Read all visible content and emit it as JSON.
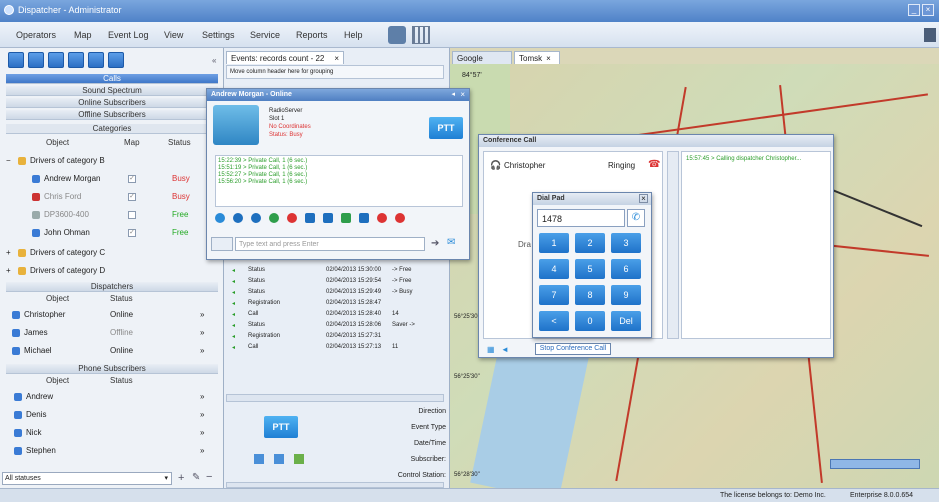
{
  "window": {
    "title": "Dispatcher - Administrator"
  },
  "menu": {
    "items": [
      "Operators",
      "Map",
      "Event Log",
      "View",
      "Settings",
      "Service",
      "Reports",
      "Help"
    ]
  },
  "left": {
    "calls": "Calls",
    "sound_spectrum": "Sound Spectrum",
    "online_subscribers": "Online Subscribers",
    "offline_subscribers": "Offline Subscribers",
    "categories": "Categories",
    "cat_headers": {
      "object": "Object",
      "map": "Map",
      "status": "Status"
    },
    "group_b": "Drivers of category B",
    "subscribers": [
      {
        "name": "Andrew Morgan",
        "status": "Busy",
        "checked": true
      },
      {
        "name": "Chris Ford",
        "status": "Busy",
        "checked": true
      },
      {
        "name": "DP3600-400",
        "status": "Free",
        "checked": false
      },
      {
        "name": "John Ohman",
        "status": "Free",
        "checked": true
      }
    ],
    "group_c": "Drivers of category C",
    "group_d": "Drivers of category D",
    "dispatchers": "Dispatchers",
    "disp_headers": {
      "object": "Object",
      "status": "Status"
    },
    "dispatcher_list": [
      {
        "name": "Christopher",
        "status": "Online"
      },
      {
        "name": "James",
        "status": "Offline"
      },
      {
        "name": "Michael",
        "status": "Online"
      }
    ],
    "phone_subscribers": "Phone Subscribers",
    "phone_headers": {
      "object": "Object",
      "status": "Status"
    },
    "phone_list": [
      "Andrew",
      "Denis",
      "Nick",
      "Stephen"
    ],
    "filter_value": "All statuses"
  },
  "center": {
    "tab": "Events: records count - 22",
    "group_hint": "Move column header here for grouping",
    "events": [
      {
        "type": "Status",
        "time": "02/04/2013 15:30:00",
        "detail": "-> Free"
      },
      {
        "type": "Status",
        "time": "02/04/2013 15:29:54",
        "detail": "-> Free"
      },
      {
        "type": "Status",
        "time": "02/04/2013 15:29:49",
        "detail": "-> Busy"
      },
      {
        "type": "Registration",
        "time": "02/04/2013 15:28:47",
        "detail": ""
      },
      {
        "type": "Call",
        "time": "02/04/2013 15:28:40",
        "detail": "14"
      },
      {
        "type": "Status",
        "time": "02/04/2013 15:28:06",
        "detail": "Saver ->"
      },
      {
        "type": "Registration",
        "time": "02/04/2013 15:27:31",
        "detail": ""
      },
      {
        "type": "Call",
        "time": "02/04/2013 15:27:13",
        "detail": "11"
      }
    ],
    "ptt": "PTT",
    "detail_labels": [
      "Direction",
      "Event Type",
      "Date/Time",
      "Subscriber:",
      "Control Station:"
    ]
  },
  "radio_popup": {
    "title": "Andrew Morgan - Online",
    "server": "RadioServer",
    "slot": "Slot 1",
    "coords": "No Coordinates",
    "status": "Status: Busy",
    "ptt": "PTT",
    "log": [
      "15:22:39 > Private Call, 1 (6 sec.)",
      "15:51:19 > Private Call, 1 (6 sec.)",
      "15:52:27 > Private Call, 1 (6 sec.)",
      "15:56:20 > Private Call, 1 (6 sec.)"
    ],
    "input_placeholder": "Type text and press Enter"
  },
  "map_tabs": [
    "Google Map",
    "Tomsk"
  ],
  "conference": {
    "title": "Conference Call",
    "participant": "Christopher",
    "state": "Ringing",
    "log": "15:57:45 > Calling dispatcher Christopher...",
    "stop": "Stop Conference Call",
    "drag_text": "Dra"
  },
  "dialpad": {
    "title": "Dial Pad",
    "number": "1478",
    "keys": [
      "1",
      "2",
      "3",
      "4",
      "5",
      "6",
      "7",
      "8",
      "9",
      "<",
      "0",
      "Del"
    ]
  },
  "map_labels": [
    "56°25'30\"",
    "56°25'30\"",
    "56°28'30\"",
    "84°57'"
  ],
  "status": {
    "license": "The license belongs to: Demo Inc.",
    "edition": "Enterprise 8.0.0.654"
  }
}
